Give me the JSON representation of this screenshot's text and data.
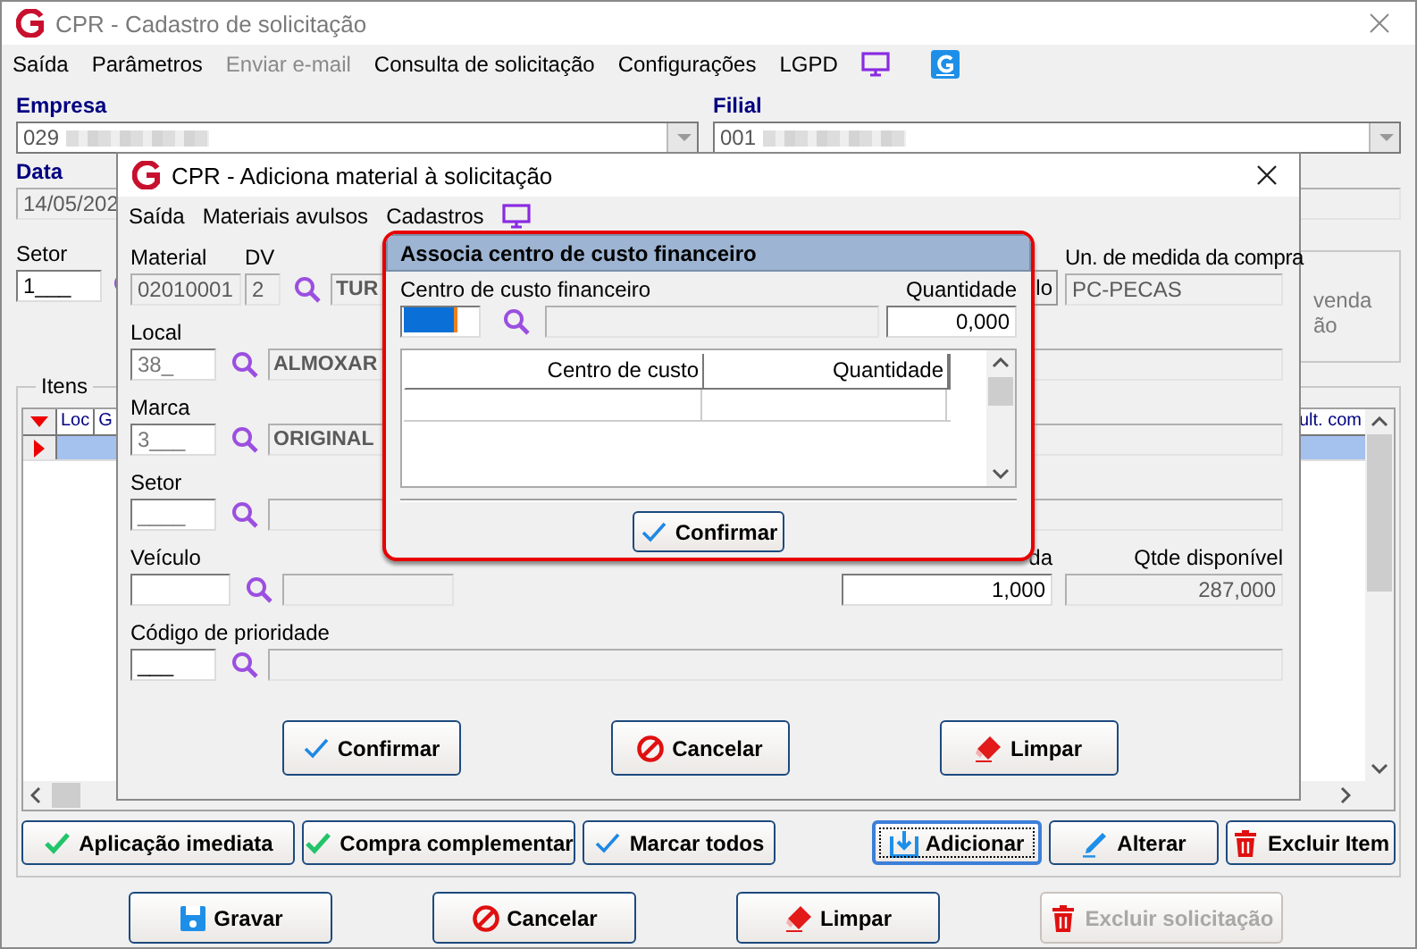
{
  "main_window": {
    "title": "CPR - Cadastro de solicitação",
    "menu": [
      {
        "label": "Saída",
        "disabled": false
      },
      {
        "label": "Parâmetros",
        "disabled": false
      },
      {
        "label": "Enviar e-mail",
        "disabled": true
      },
      {
        "label": "Consulta de solicitação",
        "disabled": false
      },
      {
        "label": "Configurações",
        "disabled": false
      },
      {
        "label": "LGPD",
        "disabled": false
      }
    ],
    "empresa": {
      "label": "Empresa",
      "value": "029"
    },
    "filial": {
      "label": "Filial",
      "value": "001"
    },
    "data": {
      "label": "Data",
      "value": "14/05/202"
    },
    "setor": {
      "label": "Setor",
      "value": "1___"
    },
    "side_panel_texts": [
      "venda",
      "ão"
    ],
    "itens": {
      "label": "Itens",
      "columns": [
        "Loc",
        "G",
        "ult. com"
      ],
      "rows": [
        {
          "selected": true
        }
      ]
    },
    "item_buttons": [
      {
        "label": "Aplicação imediata",
        "kind": "apply",
        "focused": false
      },
      {
        "label": "Compra complementar",
        "kind": "apply",
        "focused": false
      },
      {
        "label": "Marcar todos",
        "kind": "confirm",
        "focused": false
      },
      {
        "label": "Adicionar",
        "kind": "add",
        "focused": true
      },
      {
        "label": "Alterar",
        "kind": "edit",
        "focused": false
      },
      {
        "label": "Excluir Item",
        "kind": "delete",
        "focused": false
      }
    ],
    "bottom_buttons": [
      {
        "label": "Gravar",
        "kind": "save",
        "disabled": false
      },
      {
        "label": "Cancelar",
        "kind": "cancel",
        "disabled": false
      },
      {
        "label": "Limpar",
        "kind": "clear",
        "disabled": false
      },
      {
        "label": "Excluir solicitação",
        "kind": "delete",
        "disabled": true
      }
    ]
  },
  "material_window": {
    "title": "CPR - Adiciona material à solicitação",
    "menu": [
      "Saída",
      "Materiais avulsos",
      "Cadastros"
    ],
    "material": {
      "label": "Material",
      "value": "02010001"
    },
    "dv": {
      "label": "DV",
      "value": "2"
    },
    "description": "TUR",
    "hidden_button": "lo",
    "unidade": {
      "label": "Un. de medida da compra",
      "value": "PC-PECAS"
    },
    "local": {
      "label": "Local",
      "code": "38_",
      "description": "ALMOXAR"
    },
    "marca": {
      "label": "Marca",
      "code": "3___",
      "description": "ORIGINAL"
    },
    "setor": {
      "label": "Setor",
      "code": "____"
    },
    "veiculo": {
      "label": "Veículo"
    },
    "quantidade": {
      "label": "da",
      "value": "1,000"
    },
    "disponivel": {
      "label": "Qtde disponível",
      "value": "287,000"
    },
    "prioridade": {
      "label": "Código de prioridade",
      "code": "___"
    },
    "buttons": [
      {
        "label": "Confirmar",
        "kind": "confirm"
      },
      {
        "label": "Cancelar",
        "kind": "cancel"
      },
      {
        "label": "Limpar",
        "kind": "clear"
      }
    ]
  },
  "dialog": {
    "title": "Associa centro de custo financeiro",
    "centro_label": "Centro de custo financeiro",
    "quantidade_label": "Quantidade",
    "quantidade": "0,000",
    "columns": [
      "Centro de custo",
      "Quantidade"
    ],
    "button": {
      "label": "Confirmar",
      "kind": "confirm"
    }
  }
}
